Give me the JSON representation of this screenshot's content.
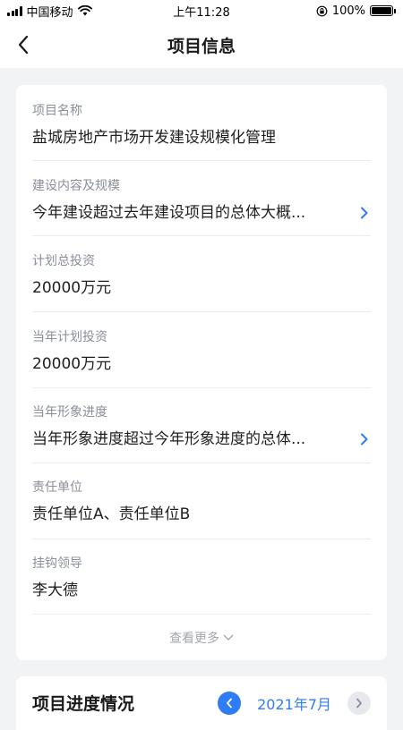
{
  "status_bar": {
    "carrier": "中国移动",
    "time": "上午11:28",
    "battery": "100%"
  },
  "nav": {
    "title": "项目信息"
  },
  "fields": [
    {
      "label": "项目名称",
      "value": "盐城房地产市场开发建设规模化管理",
      "has_arrow": false
    },
    {
      "label": "建设内容及规模",
      "value": "今年建设超过去年建设项目的总体大概...",
      "has_arrow": true
    },
    {
      "label": "计划总投资",
      "value": "20000万元",
      "has_arrow": false
    },
    {
      "label": "当年计划投资",
      "value": "20000万元",
      "has_arrow": false
    },
    {
      "label": "当年形象进度",
      "value": "当年形象进度超过今年形象进度的总体...",
      "has_arrow": true
    },
    {
      "label": "责任单位",
      "value": "责任单位A、责任单位B",
      "has_arrow": false
    },
    {
      "label": "挂钩领导",
      "value": "李大德",
      "has_arrow": false
    }
  ],
  "more_label": "查看更多",
  "progress": {
    "title": "项目进度情况",
    "month": "2021年7月"
  },
  "colors": {
    "accent": "#2f7df6",
    "label": "#8a8f99",
    "background": "#f2f3f5"
  }
}
